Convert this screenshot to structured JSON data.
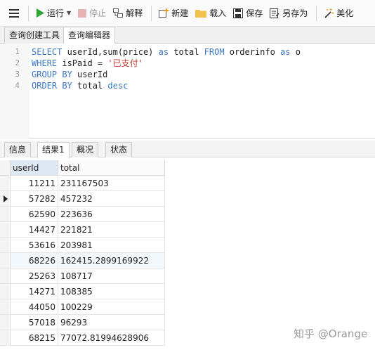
{
  "toolbar": {
    "run_label": "运行",
    "stop_label": "停止",
    "explain_label": "解释",
    "new_label": "新建",
    "load_label": "载入",
    "save_label": "保存",
    "saveas_label": "另存为",
    "beautify_label": "美化"
  },
  "query_tabs": [
    "查询创建工具",
    "查询编辑器"
  ],
  "editor": {
    "lines": [
      {
        "num": "1",
        "tokens": [
          {
            "t": "SELECT ",
            "c": "kw"
          },
          {
            "t": "userId,sum(price) ",
            "c": "plain"
          },
          {
            "t": "as ",
            "c": "kw"
          },
          {
            "t": "total ",
            "c": "plain"
          },
          {
            "t": "FROM ",
            "c": "kw"
          },
          {
            "t": "orderinfo ",
            "c": "plain"
          },
          {
            "t": "as ",
            "c": "kw"
          },
          {
            "t": "o",
            "c": "plain"
          }
        ]
      },
      {
        "num": "2",
        "tokens": [
          {
            "t": "WHERE ",
            "c": "kw"
          },
          {
            "t": "isPaid = ",
            "c": "plain"
          },
          {
            "t": "'已支付'",
            "c": "str"
          }
        ]
      },
      {
        "num": "3",
        "tokens": [
          {
            "t": "GROUP BY ",
            "c": "kw"
          },
          {
            "t": "userId",
            "c": "plain"
          }
        ]
      },
      {
        "num": "4",
        "tokens": [
          {
            "t": "ORDER BY ",
            "c": "kw"
          },
          {
            "t": "total ",
            "c": "plain"
          },
          {
            "t": "desc",
            "c": "kw"
          }
        ]
      }
    ]
  },
  "result_tabs": [
    "信息",
    "结果1",
    "概况",
    "状态"
  ],
  "grid": {
    "columns": [
      "userId",
      "total"
    ],
    "rows": [
      [
        "11211",
        "231167503"
      ],
      [
        "57282",
        "457232"
      ],
      [
        "62590",
        "223636"
      ],
      [
        "14427",
        "221821"
      ],
      [
        "53616",
        "203981"
      ],
      [
        "68226",
        "162415.2899169922"
      ],
      [
        "25263",
        "108717"
      ],
      [
        "14271",
        "108385"
      ],
      [
        "44050",
        "100229"
      ],
      [
        "57018",
        "96293"
      ],
      [
        "68215",
        "77072.81994628906"
      ]
    ]
  },
  "watermark": "知乎 @Orange",
  "colors": {
    "keyword": "#3a78c4",
    "string": "#c0392b",
    "run_icon": "#2fa52f"
  }
}
